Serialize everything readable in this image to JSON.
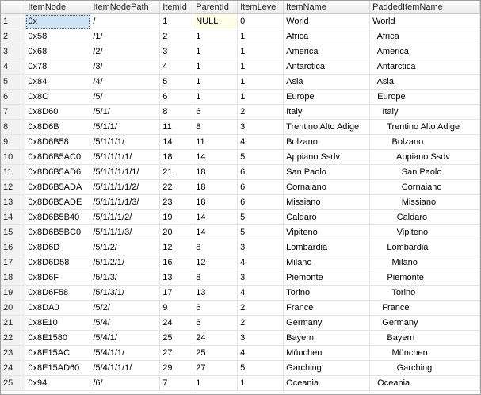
{
  "grid": {
    "columns": [
      "ItemNode",
      "ItemNodePath",
      "ItemId",
      "ParentId",
      "ItemLevel",
      "ItemName",
      "PaddedItemName"
    ],
    "rows": [
      [
        "0x",
        "/",
        "1",
        "NULL",
        "0",
        "World",
        "World"
      ],
      [
        "0x58",
        "/1/",
        "2",
        "1",
        "1",
        "Africa",
        "  Africa"
      ],
      [
        "0x68",
        "/2/",
        "3",
        "1",
        "1",
        "America",
        "  America"
      ],
      [
        "0x78",
        "/3/",
        "4",
        "1",
        "1",
        "Antarctica",
        "  Antarctica"
      ],
      [
        "0x84",
        "/4/",
        "5",
        "1",
        "1",
        "Asia",
        "  Asia"
      ],
      [
        "0x8C",
        "/5/",
        "6",
        "1",
        "1",
        "Europe",
        "  Europe"
      ],
      [
        "0x8D60",
        "/5/1/",
        "8",
        "6",
        "2",
        "Italy",
        "    Italy"
      ],
      [
        "0x8D6B",
        "/5/1/1/",
        "11",
        "8",
        "3",
        "Trentino Alto Adige",
        "      Trentino Alto Adige"
      ],
      [
        "0x8D6B58",
        "/5/1/1/1/",
        "14",
        "11",
        "4",
        "Bolzano",
        "        Bolzano"
      ],
      [
        "0x8D6B5AC0",
        "/5/1/1/1/1/",
        "18",
        "14",
        "5",
        "Appiano Ssdv",
        "          Appiano Ssdv"
      ],
      [
        "0x8D6B5AD6",
        "/5/1/1/1/1/1/",
        "21",
        "18",
        "6",
        "San Paolo",
        "            San Paolo"
      ],
      [
        "0x8D6B5ADA",
        "/5/1/1/1/1/2/",
        "22",
        "18",
        "6",
        "Cornaiano",
        "            Cornaiano"
      ],
      [
        "0x8D6B5ADE",
        "/5/1/1/1/1/3/",
        "23",
        "18",
        "6",
        "Missiano",
        "            Missiano"
      ],
      [
        "0x8D6B5B40",
        "/5/1/1/1/2/",
        "19",
        "14",
        "5",
        "Caldaro",
        "          Caldaro"
      ],
      [
        "0x8D6B5BC0",
        "/5/1/1/1/3/",
        "20",
        "14",
        "5",
        "Vipiteno",
        "          Vipiteno"
      ],
      [
        "0x8D6D",
        "/5/1/2/",
        "12",
        "8",
        "3",
        "Lombardia",
        "      Lombardia"
      ],
      [
        "0x8D6D58",
        "/5/1/2/1/",
        "16",
        "12",
        "4",
        "Milano",
        "        Milano"
      ],
      [
        "0x8D6F",
        "/5/1/3/",
        "13",
        "8",
        "3",
        "Piemonte",
        "      Piemonte"
      ],
      [
        "0x8D6F58",
        "/5/1/3/1/",
        "17",
        "13",
        "4",
        "Torino",
        "        Torino"
      ],
      [
        "0x8DA0",
        "/5/2/",
        "9",
        "6",
        "2",
        "France",
        "    France"
      ],
      [
        "0x8E10",
        "/5/4/",
        "24",
        "6",
        "2",
        "Germany",
        "    Germany"
      ],
      [
        "0x8E1580",
        "/5/4/1/",
        "25",
        "24",
        "3",
        "Bayern",
        "      Bayern"
      ],
      [
        "0x8E15AC",
        "/5/4/1/1/",
        "27",
        "25",
        "4",
        "München",
        "        München"
      ],
      [
        "0x8E15AD60",
        "/5/4/1/1/1/",
        "29",
        "27",
        "5",
        "Garching",
        "          Garching"
      ],
      [
        "0x94",
        "/6/",
        "7",
        "1",
        "1",
        "Oceania",
        "  Oceania"
      ]
    ]
  }
}
